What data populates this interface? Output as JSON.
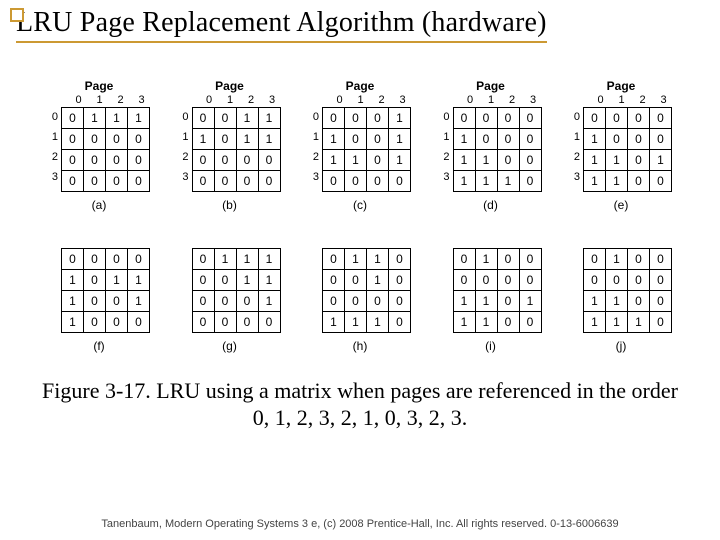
{
  "title": "LRU Page Replacement Algorithm (hardware)",
  "page_header": "Page",
  "col_labels": [
    "0",
    "1",
    "2",
    "3"
  ],
  "row_labels": [
    "0",
    "1",
    "2",
    "3"
  ],
  "matrices": {
    "a": [
      [
        "0",
        "1",
        "1",
        "1"
      ],
      [
        "0",
        "0",
        "0",
        "0"
      ],
      [
        "0",
        "0",
        "0",
        "0"
      ],
      [
        "0",
        "0",
        "0",
        "0"
      ]
    ],
    "b": [
      [
        "0",
        "0",
        "1",
        "1"
      ],
      [
        "1",
        "0",
        "1",
        "1"
      ],
      [
        "0",
        "0",
        "0",
        "0"
      ],
      [
        "0",
        "0",
        "0",
        "0"
      ]
    ],
    "c": [
      [
        "0",
        "0",
        "0",
        "1"
      ],
      [
        "1",
        "0",
        "0",
        "1"
      ],
      [
        "1",
        "1",
        "0",
        "1"
      ],
      [
        "0",
        "0",
        "0",
        "0"
      ]
    ],
    "d": [
      [
        "0",
        "0",
        "0",
        "0"
      ],
      [
        "1",
        "0",
        "0",
        "0"
      ],
      [
        "1",
        "1",
        "0",
        "0"
      ],
      [
        "1",
        "1",
        "1",
        "0"
      ]
    ],
    "e": [
      [
        "0",
        "0",
        "0",
        "0"
      ],
      [
        "1",
        "0",
        "0",
        "0"
      ],
      [
        "1",
        "1",
        "0",
        "1"
      ],
      [
        "1",
        "1",
        "0",
        "0"
      ]
    ],
    "f": [
      [
        "0",
        "0",
        "0",
        "0"
      ],
      [
        "1",
        "0",
        "1",
        "1"
      ],
      [
        "1",
        "0",
        "0",
        "1"
      ],
      [
        "1",
        "0",
        "0",
        "0"
      ]
    ],
    "g": [
      [
        "0",
        "1",
        "1",
        "1"
      ],
      [
        "0",
        "0",
        "1",
        "1"
      ],
      [
        "0",
        "0",
        "0",
        "1"
      ],
      [
        "0",
        "0",
        "0",
        "0"
      ]
    ],
    "h": [
      [
        "0",
        "1",
        "1",
        "0"
      ],
      [
        "0",
        "0",
        "1",
        "0"
      ],
      [
        "0",
        "0",
        "0",
        "0"
      ],
      [
        "1",
        "1",
        "1",
        "0"
      ]
    ],
    "i": [
      [
        "0",
        "1",
        "0",
        "0"
      ],
      [
        "0",
        "0",
        "0",
        "0"
      ],
      [
        "1",
        "1",
        "0",
        "1"
      ],
      [
        "1",
        "1",
        "0",
        "0"
      ]
    ],
    "j": [
      [
        "0",
        "1",
        "0",
        "0"
      ],
      [
        "0",
        "0",
        "0",
        "0"
      ],
      [
        "1",
        "1",
        "0",
        "0"
      ],
      [
        "1",
        "1",
        "1",
        "0"
      ]
    ]
  },
  "sub_labels": {
    "a": "(a)",
    "b": "(b)",
    "c": "(c)",
    "d": "(d)",
    "e": "(e)",
    "f": "(f)",
    "g": "(g)",
    "h": "(h)",
    "i": "(i)",
    "j": "(j)"
  },
  "caption_line1": "Figure 3-17. LRU using a matrix when pages are referenced in the order",
  "caption_line2": "0, 1, 2, 3, 2, 1, 0, 3, 2, 3.",
  "footer": "Tanenbaum, Modern Operating Systems 3 e, (c) 2008 Prentice-Hall, Inc. All rights reserved. 0-13-6006639"
}
